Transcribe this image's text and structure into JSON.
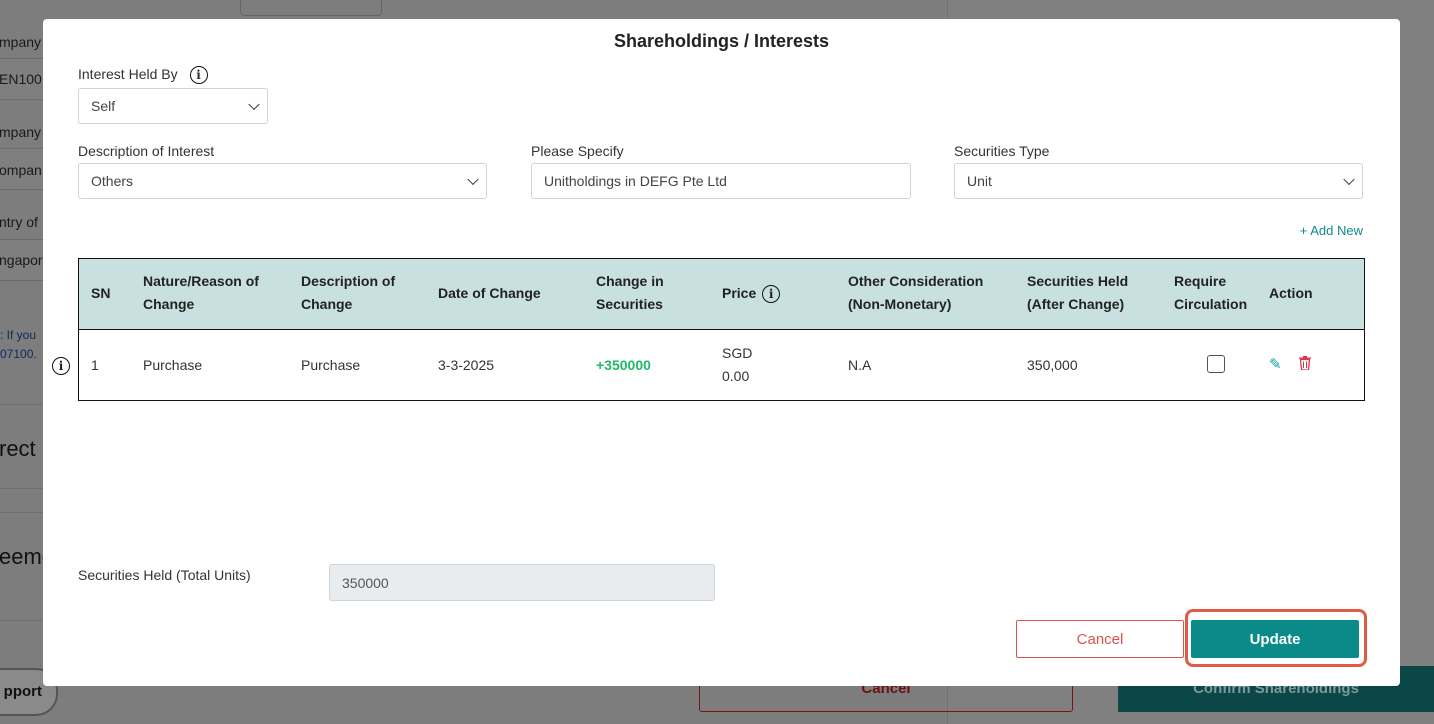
{
  "background": {
    "left_labels": [
      "mpany",
      "EN100",
      "mpany",
      "ompan",
      "ntry of",
      "ngapor"
    ],
    "link_lines": [
      ": If you",
      "07100."
    ],
    "headings": [
      "rect",
      "eeme"
    ],
    "support_label": "pport",
    "cancel_label": "Cancel",
    "confirm_label": "Confirm Shareholdings"
  },
  "modal": {
    "title": "Shareholdings / Interests",
    "interest_held_by": {
      "label": "Interest Held By",
      "value": "Self"
    },
    "description_of_interest": {
      "label": "Description of Interest",
      "value": "Others"
    },
    "please_specify": {
      "label": "Please Specify",
      "value": "Unitholdings in DEFG Pte Ltd"
    },
    "securities_type": {
      "label": "Securities Type",
      "value": "Unit"
    },
    "add_new": "+ Add New",
    "table": {
      "headers": {
        "sn": "SN",
        "nature_1": "Nature/Reason of",
        "nature_2": "Change",
        "desc_1": "Description of",
        "desc_2": "Change",
        "date": "Date of Change",
        "change_1": "Change in",
        "change_2": "Securities",
        "price": "Price",
        "other_1": "Other Consideration",
        "other_2": "(Non-Monetary)",
        "held_1": "Securities Held",
        "held_2": "(After Change)",
        "circ_1": "Require",
        "circ_2": "Circulation",
        "action": "Action"
      },
      "rows": [
        {
          "sn": "1",
          "nature": "Purchase",
          "description": "Purchase",
          "date": "3-3-2025",
          "change": "+350000",
          "price_currency": "SGD",
          "price_value": "0.00",
          "other": "N.A",
          "held": "350,000",
          "require_circulation": false
        }
      ]
    },
    "total_units": {
      "label": "Securities Held (Total Units)",
      "value": "350000"
    },
    "cancel_label": "Cancel",
    "update_label": "Update"
  },
  "colors": {
    "accent": "#0b8a8a",
    "danger": "#d9534f",
    "table_header": "#c9e0e0",
    "positive": "#1fb86a",
    "highlight": "#e05a44"
  },
  "icons": [
    "info-icon",
    "chevron-down-icon",
    "pencil-icon",
    "trash-icon"
  ]
}
